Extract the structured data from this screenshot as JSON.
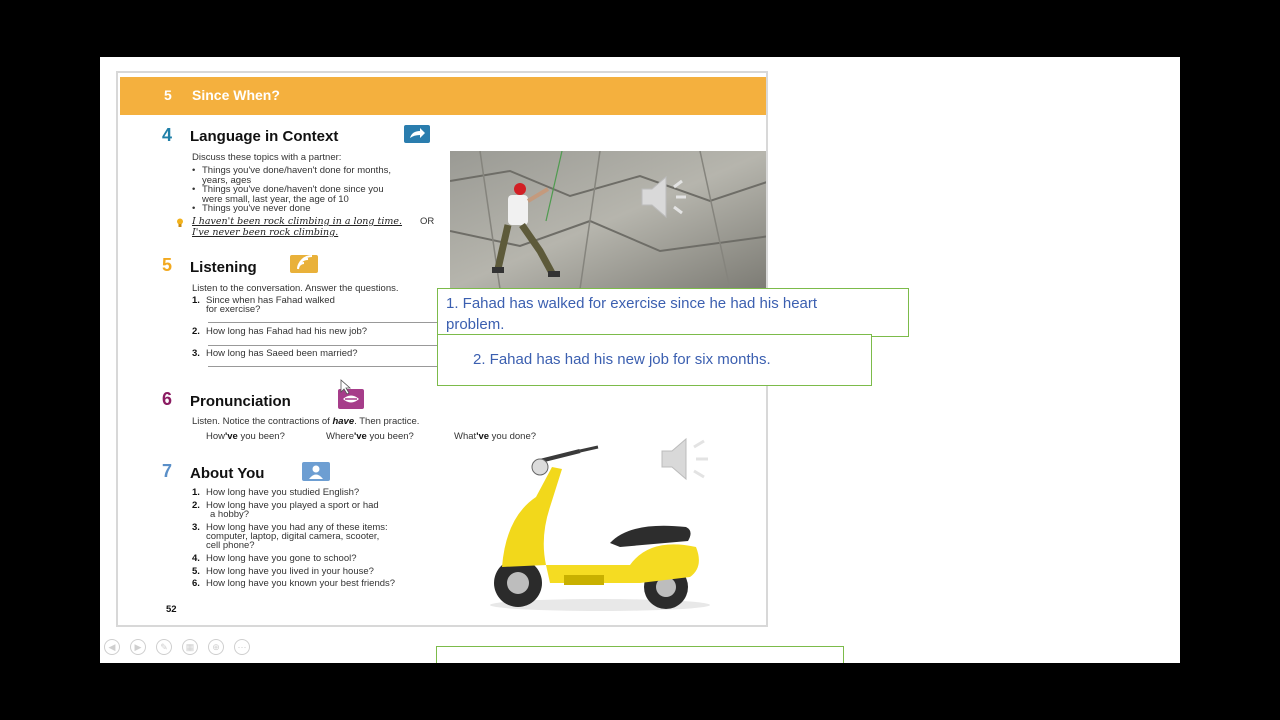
{
  "banner": {
    "number": "5",
    "title": "Since When?"
  },
  "sec4": {
    "number": "4",
    "title": "Language in Context",
    "intro": "Discuss these topics with a partner:",
    "bullets": [
      [
        "Things you've done/haven't done for months,",
        "years, ages"
      ],
      [
        "Things you've done/haven't done since you",
        "were small, last year, the age of 10"
      ],
      [
        "Things you've never done",
        ""
      ]
    ],
    "example1": "I haven't been rock climbing in a long time.",
    "example_or": "OR",
    "example2": "I've never been rock climbing."
  },
  "sec5": {
    "number": "5",
    "title": "Listening",
    "intro": "Listen to the conversation. Answer the questions.",
    "questions": [
      {
        "n": "1.",
        "text": "Since when has Fahad walked",
        "text2": "for exercise?"
      },
      {
        "n": "2.",
        "text": "How long has Fahad had his new job?"
      },
      {
        "n": "3.",
        "text": "How long has Saeed been married?"
      }
    ]
  },
  "sec6": {
    "number": "6",
    "title": "Pronunciation",
    "intro_pre": "Listen. Notice the contractions of ",
    "intro_word": "have",
    "intro_post": ". Then practice.",
    "examples": [
      {
        "a": "How",
        "b": "'ve",
        "c": " you been?"
      },
      {
        "a": "Where",
        "b": "'ve",
        "c": " you been?"
      },
      {
        "a": "What",
        "b": "'ve",
        "c": " you done?"
      }
    ]
  },
  "sec7": {
    "number": "7",
    "title": "About You",
    "items": [
      {
        "n": "1.",
        "lines": [
          "How long have you studied English?"
        ]
      },
      {
        "n": "2.",
        "lines": [
          "How long have you played a sport or had",
          "a hobby?"
        ]
      },
      {
        "n": "3.",
        "lines": [
          "How long have you had any of these items:",
          "computer, laptop, digital camera, scooter,",
          "cell phone?"
        ]
      },
      {
        "n": "4.",
        "lines": [
          "How long have you gone to school?"
        ]
      },
      {
        "n": "5.",
        "lines": [
          "How long have you lived in your house?"
        ]
      },
      {
        "n": "6.",
        "lines": [
          "How long have you known your best friends?"
        ]
      }
    ]
  },
  "page_number": "52",
  "answers": {
    "a1_line1": "1. Fahad has walked for exercise since he had his heart",
    "a1_line2": "problem.",
    "a2": "2. Fahad has had his new job for six months."
  },
  "colors": {
    "banner": "#f4b03e",
    "sec4": "#1f7fa8",
    "sec5": "#f2a91f",
    "sec6": "#8b1c62",
    "sec7": "#5a8fc8",
    "answer_text": "#3b5fb0",
    "answer_border": "#7cbb4a"
  },
  "icons": [
    "arrow-share-icon",
    "audio-listening-icon",
    "pronunciation-mouth-icon",
    "person-icon",
    "speaker-icon",
    "tip-bulb-icon",
    "mouse-cursor-icon"
  ],
  "controls": [
    "previous-icon",
    "next-icon",
    "pen-icon",
    "slides-icon",
    "zoom-icon",
    "more-icon"
  ]
}
